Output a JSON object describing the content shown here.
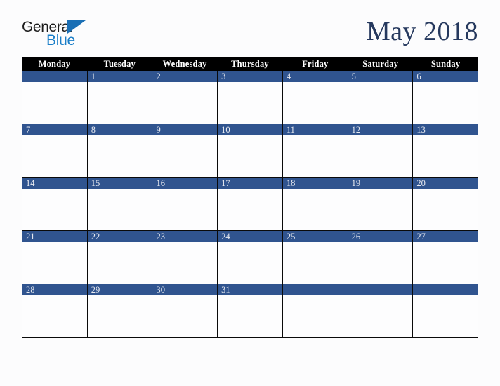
{
  "brand": {
    "name_part1": "General",
    "name_part2": "Blue",
    "triangle_color": "#1a6fb5",
    "text_color_part1": "#1c1c1c",
    "text_color_part2": "#1a7ec8"
  },
  "header": {
    "title": "May 2018",
    "title_color": "#26395e"
  },
  "calendar": {
    "month": "May",
    "year": "2018",
    "week_start": "Monday",
    "header_background": "#000000",
    "header_text_color": "#ffffff",
    "day_band_color": "#30548f",
    "day_number_color": "#e8eaf0",
    "cell_background": "#fdfdfe",
    "border_color": "#0a0a0a",
    "weekdays": [
      "Monday",
      "Tuesday",
      "Wednesday",
      "Thursday",
      "Friday",
      "Saturday",
      "Sunday"
    ],
    "weeks": [
      [
        "",
        "1",
        "2",
        "3",
        "4",
        "5",
        "6"
      ],
      [
        "7",
        "8",
        "9",
        "10",
        "11",
        "12",
        "13"
      ],
      [
        "14",
        "15",
        "16",
        "17",
        "18",
        "19",
        "20"
      ],
      [
        "21",
        "22",
        "23",
        "24",
        "25",
        "26",
        "27"
      ],
      [
        "28",
        "29",
        "30",
        "31",
        "",
        "",
        ""
      ]
    ]
  }
}
